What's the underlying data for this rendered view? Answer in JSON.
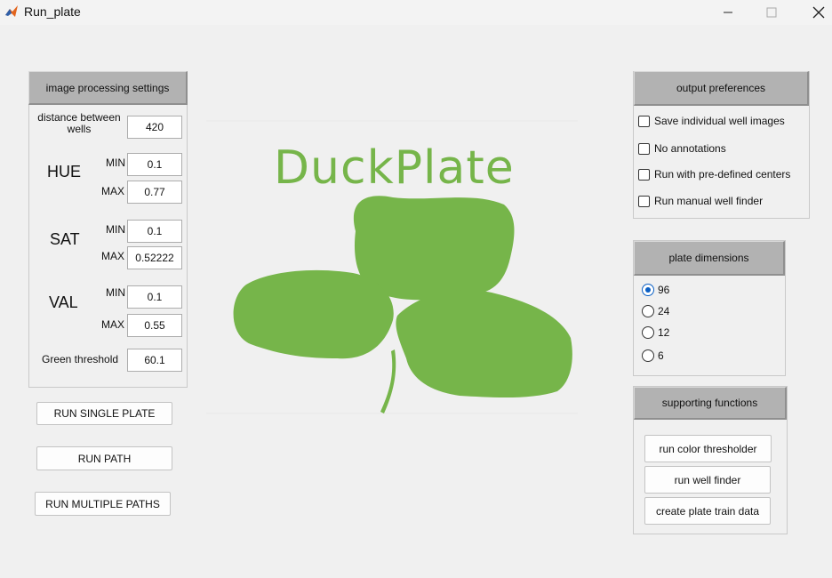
{
  "window": {
    "title": "Run_plate",
    "controls": [
      "minimize-icon",
      "maximize-icon",
      "close-icon"
    ]
  },
  "image_processing": {
    "header": "image processing settings",
    "distance_label": "distance between wells",
    "distance_value": "420",
    "hue": {
      "label": "HUE",
      "min_label": "MIN",
      "min_value": "0.1",
      "max_label": "MAX",
      "max_value": "0.77"
    },
    "sat": {
      "label": "SAT",
      "min_label": "MIN",
      "min_value": "0.1",
      "max_label": "MAX",
      "max_value": "0.52222"
    },
    "val": {
      "label": "VAL",
      "min_label": "MIN",
      "min_value": "0.1",
      "max_label": "MAX",
      "max_value": "0.55"
    },
    "green_label": "Green threshold",
    "green_value": "60.1"
  },
  "actions": {
    "run_single": "RUN SINGLE PLATE",
    "run_path": "RUN PATH",
    "run_multiple": "RUN MULTIPLE PATHS"
  },
  "logo": {
    "text": "DuckPlate",
    "color": "#76b54a",
    "icon": "clover-icon"
  },
  "output_preferences": {
    "header": "output preferences",
    "options": [
      {
        "label": "Save individual well images",
        "checked": false
      },
      {
        "label": "No annotations",
        "checked": false
      },
      {
        "label": "Run with pre-defined centers",
        "checked": false
      },
      {
        "label": "Run manual well finder",
        "checked": false
      }
    ]
  },
  "plate_dimensions": {
    "header": "plate dimensions",
    "options": [
      "96",
      "24",
      "12",
      "6"
    ],
    "selected": "96"
  },
  "supporting_functions": {
    "header": "supporting functions",
    "buttons": [
      "run color thresholder",
      "run well finder",
      "create plate train data"
    ]
  },
  "colors": {
    "accent": "#0a5fc4",
    "header_bg": "#b2b2b2",
    "logo_green": "#76b54a"
  }
}
